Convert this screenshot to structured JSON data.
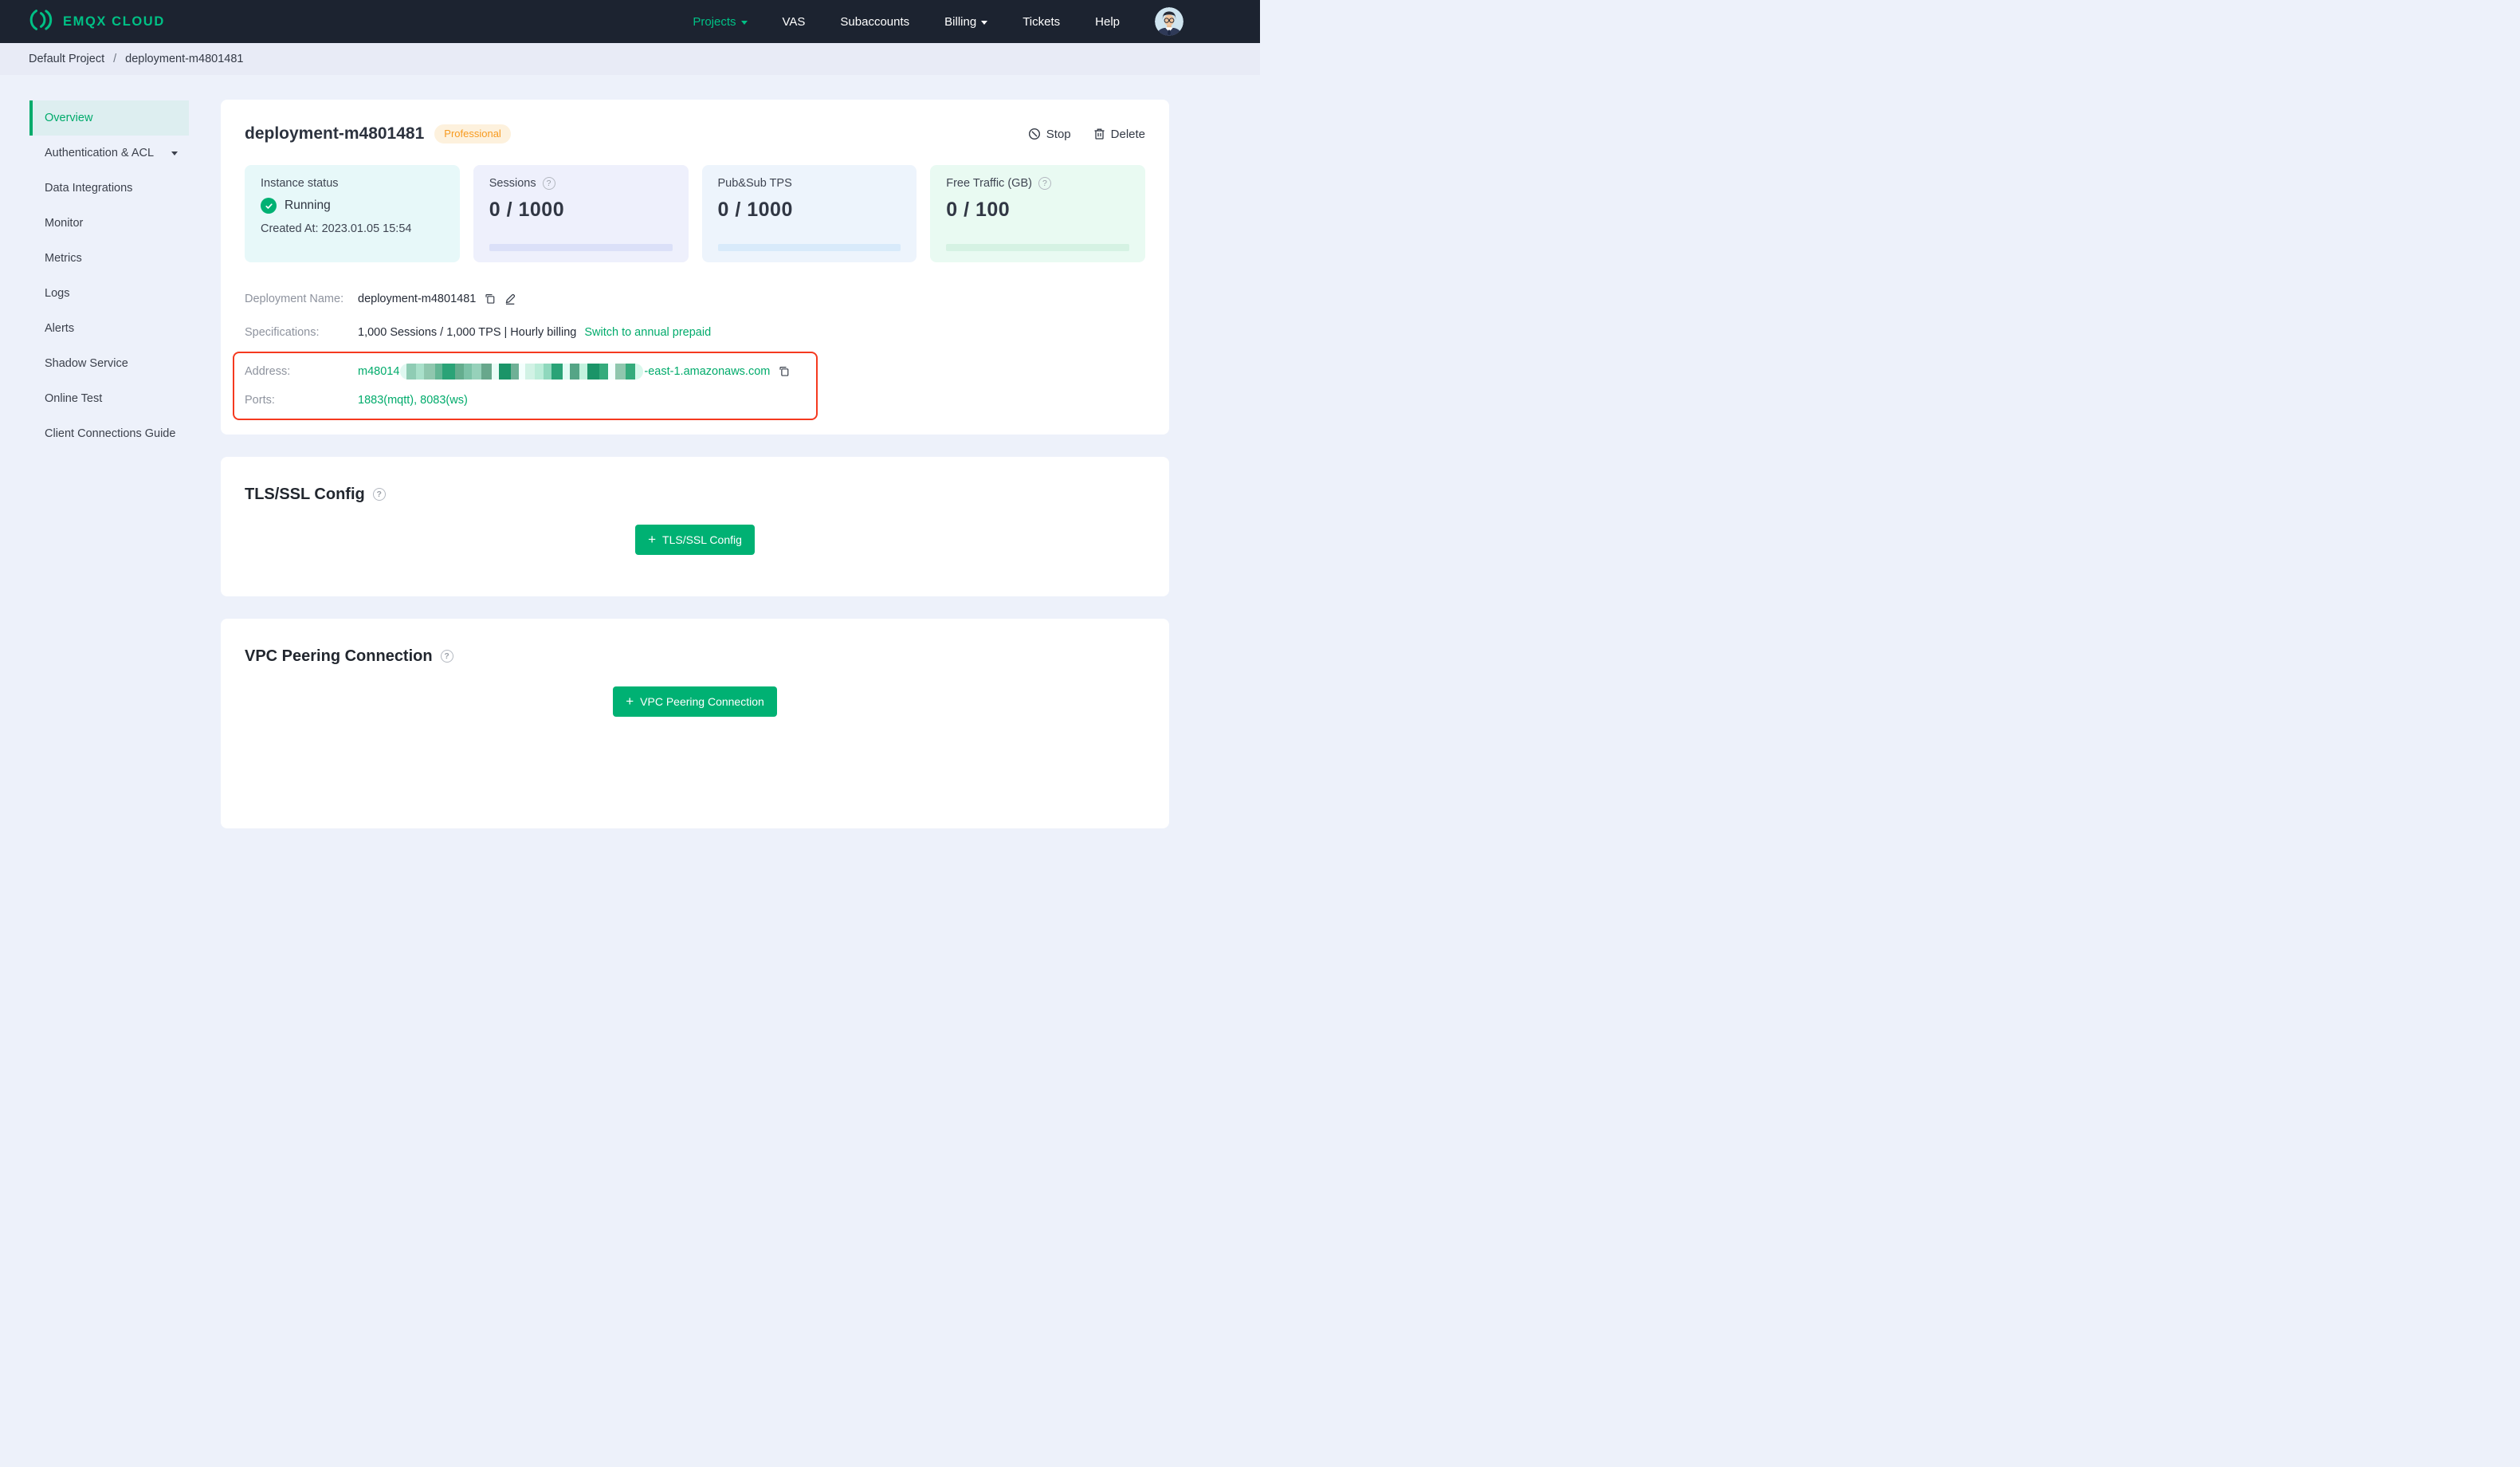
{
  "nav": {
    "brand": "EMQX CLOUD",
    "items": [
      {
        "label": "Projects"
      },
      {
        "label": "VAS"
      },
      {
        "label": "Subaccounts"
      },
      {
        "label": "Billing"
      },
      {
        "label": "Tickets"
      },
      {
        "label": "Help"
      }
    ]
  },
  "breadcrumb": {
    "project": "Default Project",
    "separator": "/",
    "deployment": "deployment-m4801481"
  },
  "sidebar": {
    "items": [
      {
        "label": "Overview"
      },
      {
        "label": "Authentication & ACL"
      },
      {
        "label": "Data Integrations"
      },
      {
        "label": "Monitor"
      },
      {
        "label": "Metrics"
      },
      {
        "label": "Logs"
      },
      {
        "label": "Alerts"
      },
      {
        "label": "Shadow Service"
      },
      {
        "label": "Online Test"
      },
      {
        "label": "Client Connections Guide"
      }
    ]
  },
  "deployment": {
    "title": "deployment-m4801481",
    "plan_badge": "Professional",
    "actions": {
      "stop": "Stop",
      "delete": "Delete"
    },
    "stats": {
      "instance_status": {
        "label": "Instance status",
        "status": "Running",
        "created_at": "Created At: 2023.01.05 15:54"
      },
      "sessions": {
        "label": "Sessions",
        "value": "0 / 1000"
      },
      "pubsub_tps": {
        "label": "Pub&Sub TPS",
        "value": "0 / 1000"
      },
      "free_traffic": {
        "label": "Free Traffic (GB)",
        "value": "0 / 100"
      }
    },
    "info": {
      "deployment_name": {
        "label": "Deployment Name:",
        "value": "deployment-m4801481"
      },
      "specifications": {
        "label": "Specifications:",
        "value": "1,000 Sessions / 1,000 TPS | Hourly billing",
        "link": "Switch to annual prepaid"
      },
      "address": {
        "label": "Address:",
        "prefix": "m48014",
        "suffix": "-east-1.amazonaws.com",
        "redacted_blocks": [
          {
            "c": "#dff8f0",
            "w": 8
          },
          {
            "c": "#8fccb4",
            "w": 12
          },
          {
            "c": "#a9e0ca",
            "w": 10
          },
          {
            "c": "#8fc7ae",
            "w": 14
          },
          {
            "c": "#63b694",
            "w": 9
          },
          {
            "c": "#2aa377",
            "w": 16
          },
          {
            "c": "#64ad8e",
            "w": 11
          },
          {
            "c": "#7cc2a7",
            "w": 10
          },
          {
            "c": "#96d1ba",
            "w": 12
          },
          {
            "c": "#68a78c",
            "w": 13
          },
          {
            "c": "#eafcf7",
            "w": 9
          },
          {
            "c": "#1b9468",
            "w": 15
          },
          {
            "c": "#6fb096",
            "w": 10
          },
          {
            "c": "#f4fffd",
            "w": 8
          },
          {
            "c": "#d1f2e5",
            "w": 12
          },
          {
            "c": "#baecd8",
            "w": 11
          },
          {
            "c": "#8fd8bd",
            "w": 10
          },
          {
            "c": "#2aa377",
            "w": 14
          },
          {
            "c": "#e2fbf4",
            "w": 9
          },
          {
            "c": "#55a586",
            "w": 12
          },
          {
            "c": "#c2f2de",
            "w": 10
          },
          {
            "c": "#1b9468",
            "w": 15
          },
          {
            "c": "#35ab7c",
            "w": 11
          },
          {
            "c": "#f4fffd",
            "w": 9
          },
          {
            "c": "#8fc7ae",
            "w": 13
          },
          {
            "c": "#35ab7c",
            "w": 12
          },
          {
            "c": "#d9f8ec",
            "w": 10
          }
        ]
      },
      "ports": {
        "label": "Ports:",
        "value": "1883(mqtt), 8083(ws)"
      }
    }
  },
  "sections": {
    "tls": {
      "title": "TLS/SSL Config",
      "button": "TLS/SSL Config"
    },
    "vpc": {
      "title": "VPC Peering Connection",
      "button": "VPC Peering Connection"
    }
  },
  "icons": {
    "help": "?",
    "check": "✓",
    "plus": "+"
  },
  "colors": {
    "brand_green": "#00b173",
    "link_green": "#00ab6b",
    "badge_orange": "#f79a1f",
    "annotation_red": "#f5391f",
    "nav_dark": "#1c2330"
  }
}
